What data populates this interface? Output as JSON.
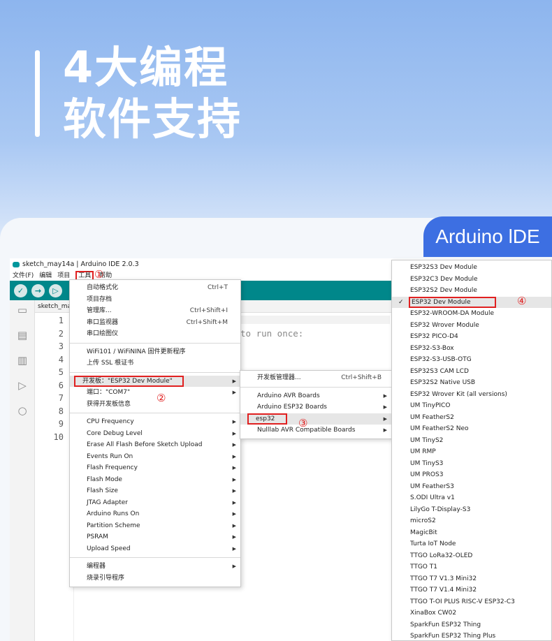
{
  "hero": {
    "line1": "4大编程",
    "line2": "软件支持"
  },
  "badge": "Arduino lDE",
  "ide": {
    "title": "sketch_may14a | Arduino IDE 2.0.3",
    "menubar": [
      "文件(F)",
      "编辑",
      "项目",
      "工具",
      "帮助"
    ],
    "tab_label": "sketch_may",
    "line_numbers": [
      "1",
      "2",
      "3",
      "4",
      "5",
      "6",
      "7",
      "8",
      "9",
      "10"
    ],
    "code_fragment": "to run once:"
  },
  "tools_menu": {
    "group1": [
      {
        "label": "自动格式化",
        "shortcut": "Ctrl+T"
      },
      {
        "label": "项目存档",
        "shortcut": ""
      },
      {
        "label": "管理库...",
        "shortcut": "Ctrl+Shift+I"
      },
      {
        "label": "串口监视器",
        "shortcut": "Ctrl+Shift+M"
      },
      {
        "label": "串口绘图仪",
        "shortcut": ""
      }
    ],
    "group2": [
      {
        "label": "WiFi101 / WiFiNINA 固件更新程序"
      },
      {
        "label": "上传 SSL 根证书"
      }
    ],
    "group3": [
      {
        "label": "开发板：\"ESP32 Dev Module\"",
        "submenu": true
      },
      {
        "label": "端口：\"COM7\"",
        "submenu": true
      },
      {
        "label": "获得开发板信息",
        "submenu": false
      }
    ],
    "group4": [
      "CPU Frequency",
      "Core Debug Level",
      "Erase All Flash Before Sketch Upload",
      "Events Run On",
      "Flash Frequency",
      "Flash Mode",
      "Flash Size",
      "JTAG Adapter",
      "Arduino Runs On",
      "Partition Scheme",
      "PSRAM",
      "Upload Speed"
    ],
    "group5": [
      {
        "label": "编程器",
        "submenu": true
      },
      {
        "label": "烧录引导程序",
        "submenu": false
      }
    ]
  },
  "board_menu": {
    "manager": {
      "label": "开发板管理器...",
      "shortcut": "Ctrl+Shift+B"
    },
    "items": [
      "Arduino AVR Boards",
      "Arduino ESP32 Boards",
      "esp32",
      "Nulllab AVR Compatible Boards"
    ]
  },
  "esp32_boards": [
    "ESP32S3 Dev Module",
    "ESP32C3 Dev Module",
    "ESP32S2 Dev Module",
    "ESP32 Dev Module",
    "ESP32-WROOM-DA Module",
    "ESP32 Wrover Module",
    "ESP32 PICO-D4",
    "ESP32-S3-Box",
    "ESP32-S3-USB-OTG",
    "ESP32S3 CAM LCD",
    "ESP32S2 Native USB",
    "ESP32 Wrover Kit (all versions)",
    "UM TinyPICO",
    "UM FeatherS2",
    "UM FeatherS2 Neo",
    "UM TinyS2",
    "UM RMP",
    "UM TinyS3",
    "UM PROS3",
    "UM FeatherS3",
    "S.ODI Ultra v1",
    "LilyGo T-Display-S3",
    "microS2",
    "MagicBit",
    "Turta IoT Node",
    "TTGO LoRa32-OLED",
    "TTGO T1",
    "TTGO T7 V1.3 Mini32",
    "TTGO T7 V1.4 Mini32",
    "TTGO T-OI PLUS RISC-V ESP32-C3",
    "XinaBox CW02",
    "SparkFun ESP32 Thing",
    "SparkFun ESP32 Thing Plus"
  ],
  "step_marks": [
    "①",
    "②",
    "③",
    "④"
  ],
  "colors": {
    "accent": "#00878a",
    "badge": "#3d6fe2",
    "highlight_box": "#e02020"
  }
}
